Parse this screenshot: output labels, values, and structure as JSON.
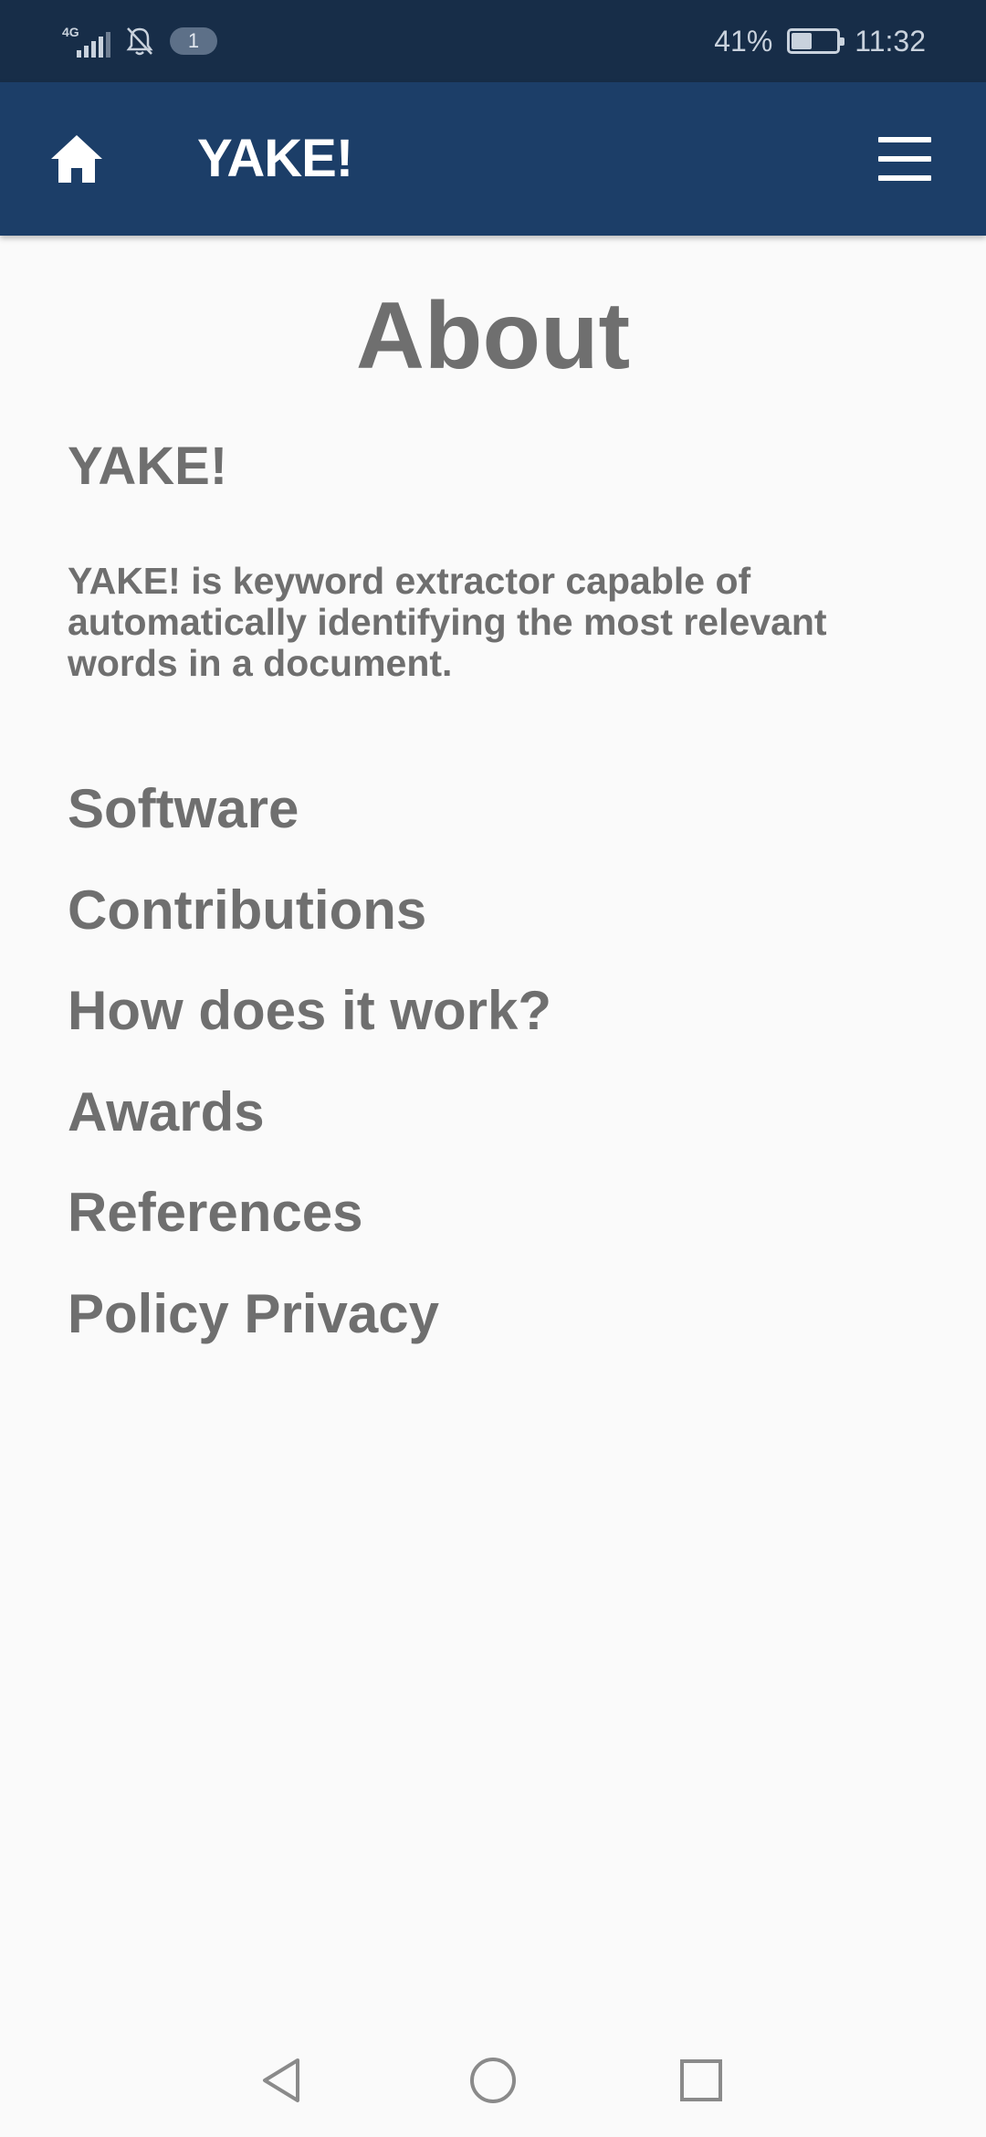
{
  "status_bar": {
    "network": "4G",
    "notification_count": "1",
    "battery_percent": "41%",
    "battery_level": 0.41,
    "time": "11:32",
    "icons": [
      "signal-icon",
      "bell-muted-icon",
      "battery-icon"
    ]
  },
  "app_bar": {
    "title": "YAKE!",
    "icons": [
      "home-icon",
      "hamburger-menu-icon"
    ],
    "color": "#1c3e68"
  },
  "main": {
    "page_title": "About",
    "section_heading": "YAKE!",
    "description": "YAKE! is keyword extractor capable of automatically identifying the most relevant words in a document.",
    "items": [
      {
        "label": "Software"
      },
      {
        "label": "Contributions"
      },
      {
        "label": "How does it work?"
      },
      {
        "label": "Awards"
      },
      {
        "label": "References"
      },
      {
        "label": "Policy Privacy"
      }
    ]
  },
  "navigation_bar": {
    "icons": [
      "back-triangle-icon",
      "home-circle-icon",
      "recents-square-icon"
    ]
  }
}
